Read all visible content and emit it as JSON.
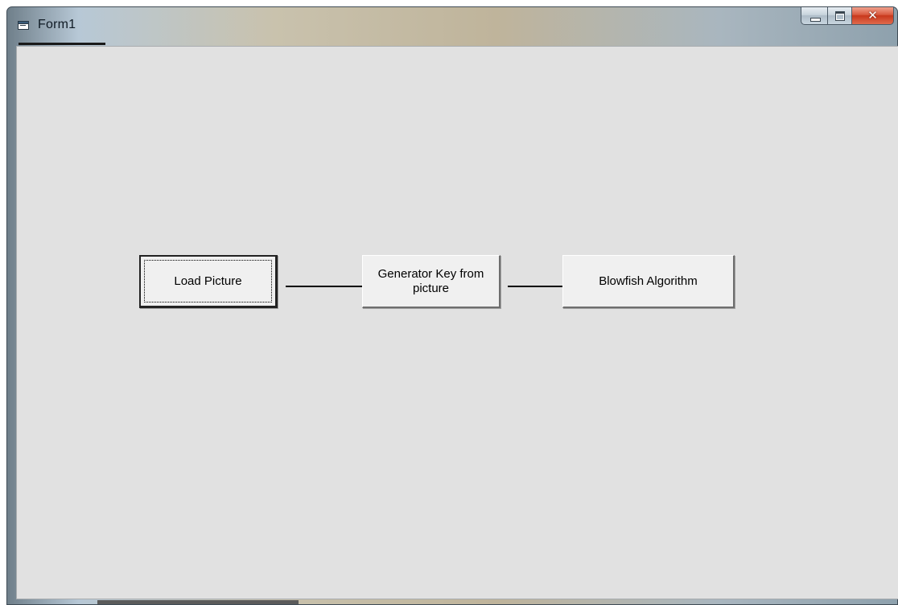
{
  "window": {
    "title": "Form1",
    "icon": "form-window-icon",
    "caption_buttons": {
      "minimize": "minimize-icon",
      "maximize": "maximize-icon",
      "close": "close-icon"
    }
  },
  "form": {
    "buttons": {
      "load_picture": "Load Picture",
      "generator_key": "Generator Key from picture",
      "blowfish": "Blowfish Algorithm"
    }
  },
  "colors": {
    "client_background": "#e1e1e1",
    "button_face": "#f0f0f0",
    "close_button": "#c8381c"
  }
}
